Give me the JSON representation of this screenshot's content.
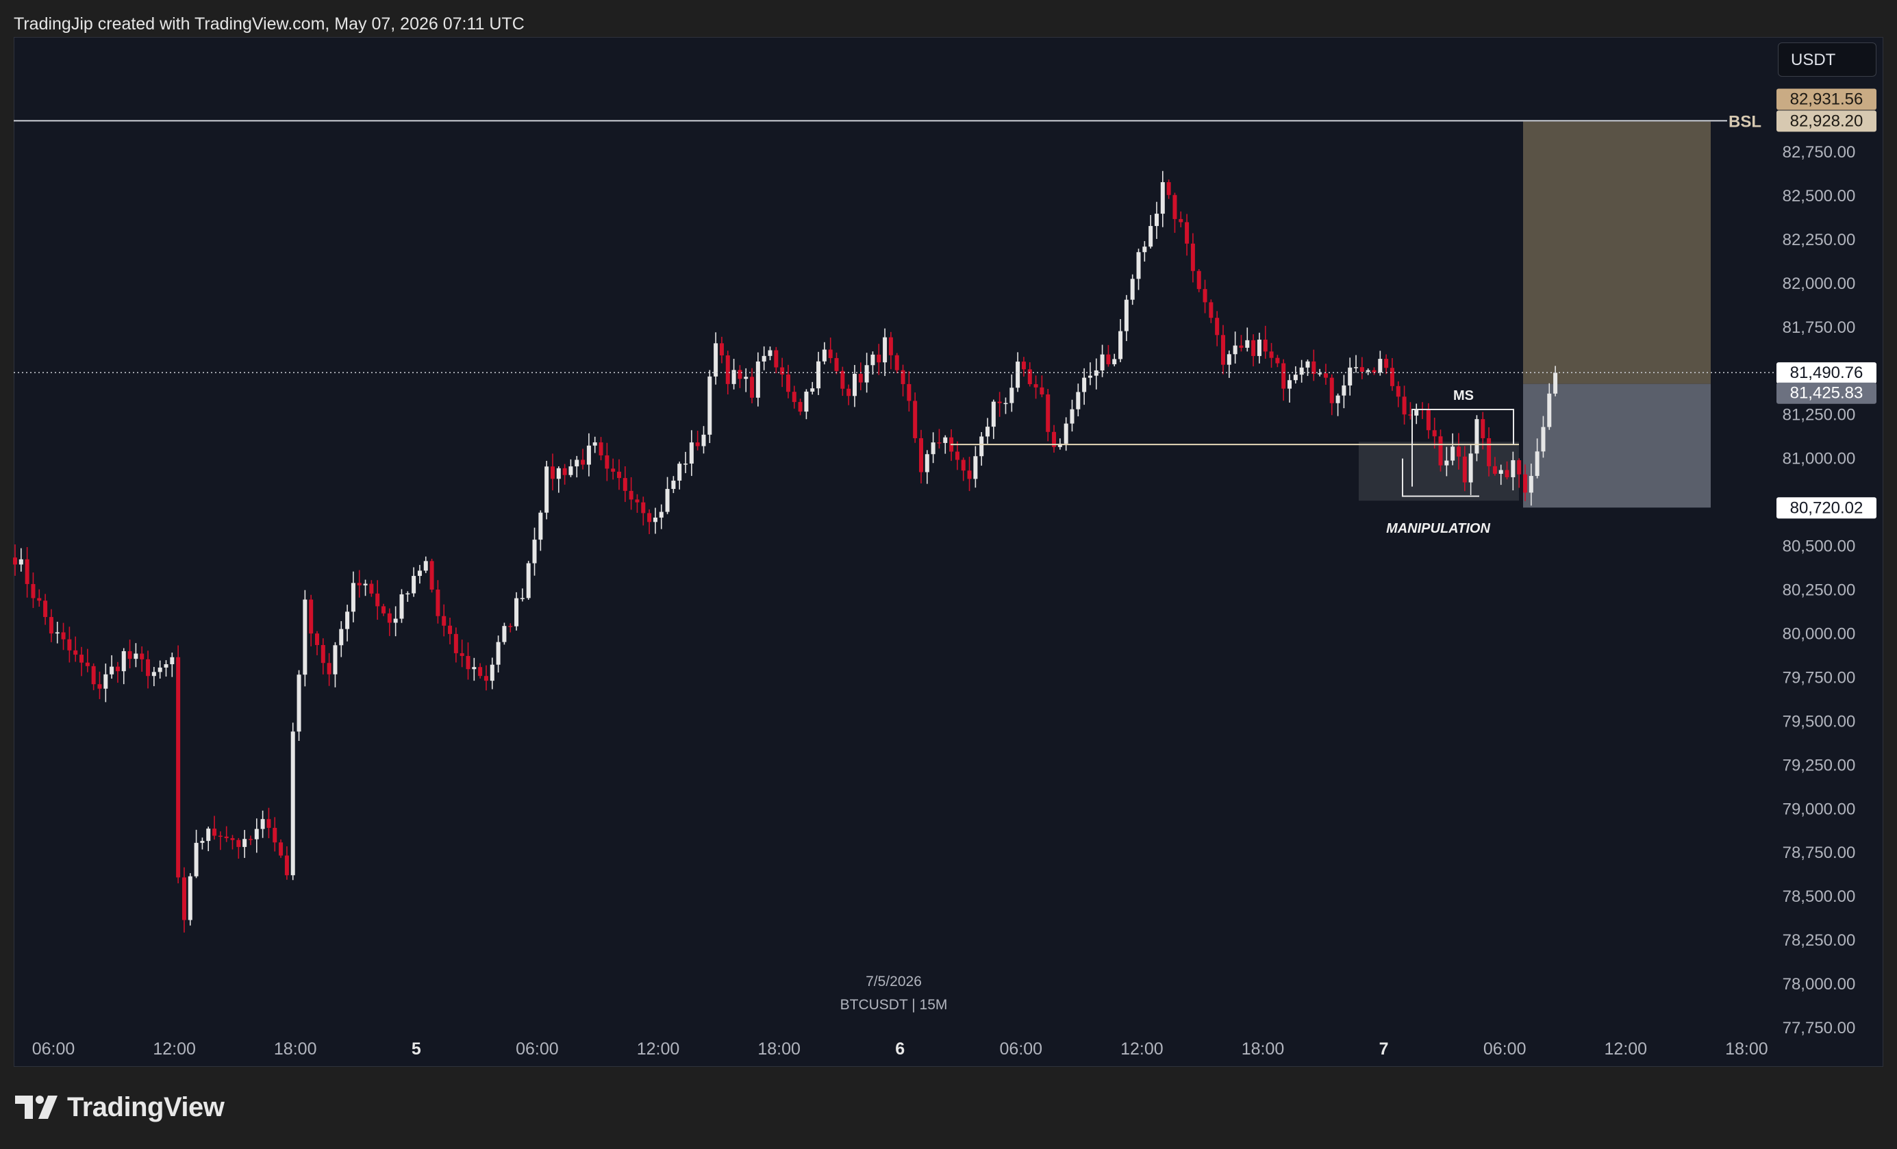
{
  "header": {
    "attribution": "TradingJip created with TradingView.com, May 07, 2026 07:11 UTC"
  },
  "price_axis": {
    "unit_label": "USDT",
    "ticks": [
      "82,750.00",
      "82,500.00",
      "82,250.00",
      "82,000.00",
      "81,750.00",
      "81,250.00",
      "81,000.00",
      "80,500.00",
      "80,250.00",
      "80,000.00",
      "79,750.00",
      "79,500.00",
      "79,250.00",
      "79,000.00",
      "78,750.00",
      "78,500.00",
      "78,250.00",
      "78,000.00",
      "77,750.00"
    ],
    "tags": {
      "target_price": "82,931.56",
      "bsl_price": "82,928.20",
      "last_price": "81,490.76",
      "entry_price": "81,425.83",
      "stop_price": "80,720.02"
    }
  },
  "time_axis": {
    "ticks": [
      "06:00",
      "12:00",
      "18:00",
      "5",
      "06:00",
      "12:00",
      "18:00",
      "6",
      "06:00",
      "12:00",
      "18:00",
      "7",
      "06:00",
      "12:00",
      "18:00"
    ]
  },
  "annotations": {
    "bsl_label": "BSL",
    "ms_label": "MS",
    "manipulation_label": "MANIPULATION",
    "date_label": "7/5/2026",
    "symbol_label": "BTCUSDT | 15M"
  },
  "colors": {
    "background": "#131722",
    "bull": "#e6e6e6",
    "bear": "#d0102a",
    "target_zone": "#5a5346",
    "stop_zone": "#5a5f6b",
    "target_tag": "#c9ab84",
    "bsl_tag": "#d7c9b1"
  },
  "logo": {
    "text": "TradingView"
  },
  "chart_data": {
    "type": "candlestick",
    "symbol": "BTCUSDT",
    "timeframe": "15M",
    "ylim": [
      77750,
      83050
    ],
    "levels": {
      "bsl": 82928.2,
      "target": 82931.56,
      "last": 81490.76,
      "entry": 81425.83,
      "stop": 80720.02,
      "ms_level": 81080
    },
    "path": [
      [
        0,
        80450
      ],
      [
        6,
        80020
      ],
      [
        10,
        79860
      ],
      [
        14,
        79700
      ],
      [
        18,
        79880
      ],
      [
        24,
        79760
      ],
      [
        26,
        79850
      ],
      [
        27,
        78600
      ],
      [
        28,
        78320
      ],
      [
        30,
        78820
      ],
      [
        34,
        78880
      ],
      [
        38,
        78780
      ],
      [
        42,
        78940
      ],
      [
        45,
        78620
      ],
      [
        46,
        79450
      ],
      [
        48,
        80150
      ],
      [
        52,
        79750
      ],
      [
        56,
        80300
      ],
      [
        58,
        80300
      ],
      [
        62,
        80050
      ],
      [
        64,
        80180
      ],
      [
        68,
        80400
      ],
      [
        70,
        80100
      ],
      [
        72,
        79950
      ],
      [
        74,
        79850
      ],
      [
        78,
        79750
      ],
      [
        80,
        79920
      ],
      [
        84,
        80250
      ],
      [
        88,
        80900
      ],
      [
        92,
        80960
      ],
      [
        96,
        81050
      ],
      [
        98,
        80900
      ],
      [
        102,
        80820
      ],
      [
        106,
        80650
      ],
      [
        110,
        80950
      ],
      [
        114,
        81150
      ],
      [
        116,
        81700
      ],
      [
        118,
        81480
      ],
      [
        122,
        81400
      ],
      [
        124,
        81620
      ],
      [
        130,
        81300
      ],
      [
        134,
        81600
      ],
      [
        138,
        81400
      ],
      [
        142,
        81550
      ],
      [
        144,
        81650
      ],
      [
        146,
        81450
      ],
      [
        148,
        81300
      ],
      [
        150,
        80950
      ],
      [
        154,
        81150
      ],
      [
        156,
        80950
      ],
      [
        158,
        80900
      ],
      [
        162,
        81300
      ],
      [
        164,
        81350
      ],
      [
        166,
        81500
      ],
      [
        170,
        81320
      ],
      [
        172,
        81050
      ],
      [
        176,
        81350
      ],
      [
        180,
        81600
      ],
      [
        182,
        81550
      ],
      [
        184,
        81900
      ],
      [
        186,
        82150
      ],
      [
        188,
        82300
      ],
      [
        190,
        82600
      ],
      [
        192,
        82400
      ],
      [
        194,
        82250
      ],
      [
        196,
        81950
      ],
      [
        198,
        81850
      ],
      [
        200,
        81500
      ],
      [
        202,
        81600
      ],
      [
        206,
        81650
      ],
      [
        210,
        81450
      ],
      [
        214,
        81600
      ],
      [
        218,
        81350
      ],
      [
        222,
        81550
      ],
      [
        224,
        81450
      ],
      [
        226,
        81550
      ],
      [
        230,
        81300
      ],
      [
        234,
        81200
      ],
      [
        236,
        80960
      ],
      [
        238,
        81100
      ],
      [
        240,
        80900
      ],
      [
        242,
        81250
      ],
      [
        244,
        80950
      ],
      [
        246,
        80880
      ],
      [
        248,
        81000
      ],
      [
        250,
        80860
      ],
      [
        252,
        81050
      ],
      [
        254,
        81400
      ],
      [
        255,
        81490
      ]
    ]
  }
}
